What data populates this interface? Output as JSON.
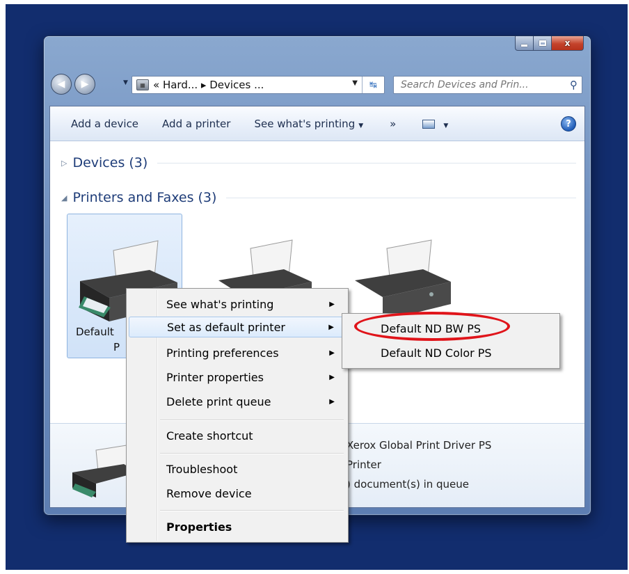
{
  "window": {
    "minimize_glyph": "",
    "close_glyph": "x"
  },
  "nav": {
    "back_glyph": "◀",
    "forward_glyph": "▶",
    "address_text": "« Hard... ▸ Devices ...",
    "search_placeholder": "Search Devices and Prin..."
  },
  "toolbar": {
    "items": [
      "Add a device",
      "Add a printer",
      "See what's printing",
      "»"
    ],
    "help_glyph": "?"
  },
  "groups": {
    "devices": "Devices (3)",
    "printers": "Printers and Faxes (3)"
  },
  "printers": {
    "selected_label_line1": "Default",
    "selected_label_line2": "P"
  },
  "details": {
    "line1": "Xerox Global Print Driver PS",
    "line2": "Printer",
    "line3": ") document(s) in queue"
  },
  "context_menu": {
    "items": [
      "See what's printing",
      "Set as default printer",
      "Printing preferences",
      "Printer properties",
      "Delete print queue",
      "Create shortcut",
      "Troubleshoot",
      "Remove device",
      "Properties"
    ]
  },
  "submenu": {
    "items": [
      "Default ND BW PS",
      "Default ND Color PS"
    ],
    "highlight_color": "#e0141a"
  }
}
